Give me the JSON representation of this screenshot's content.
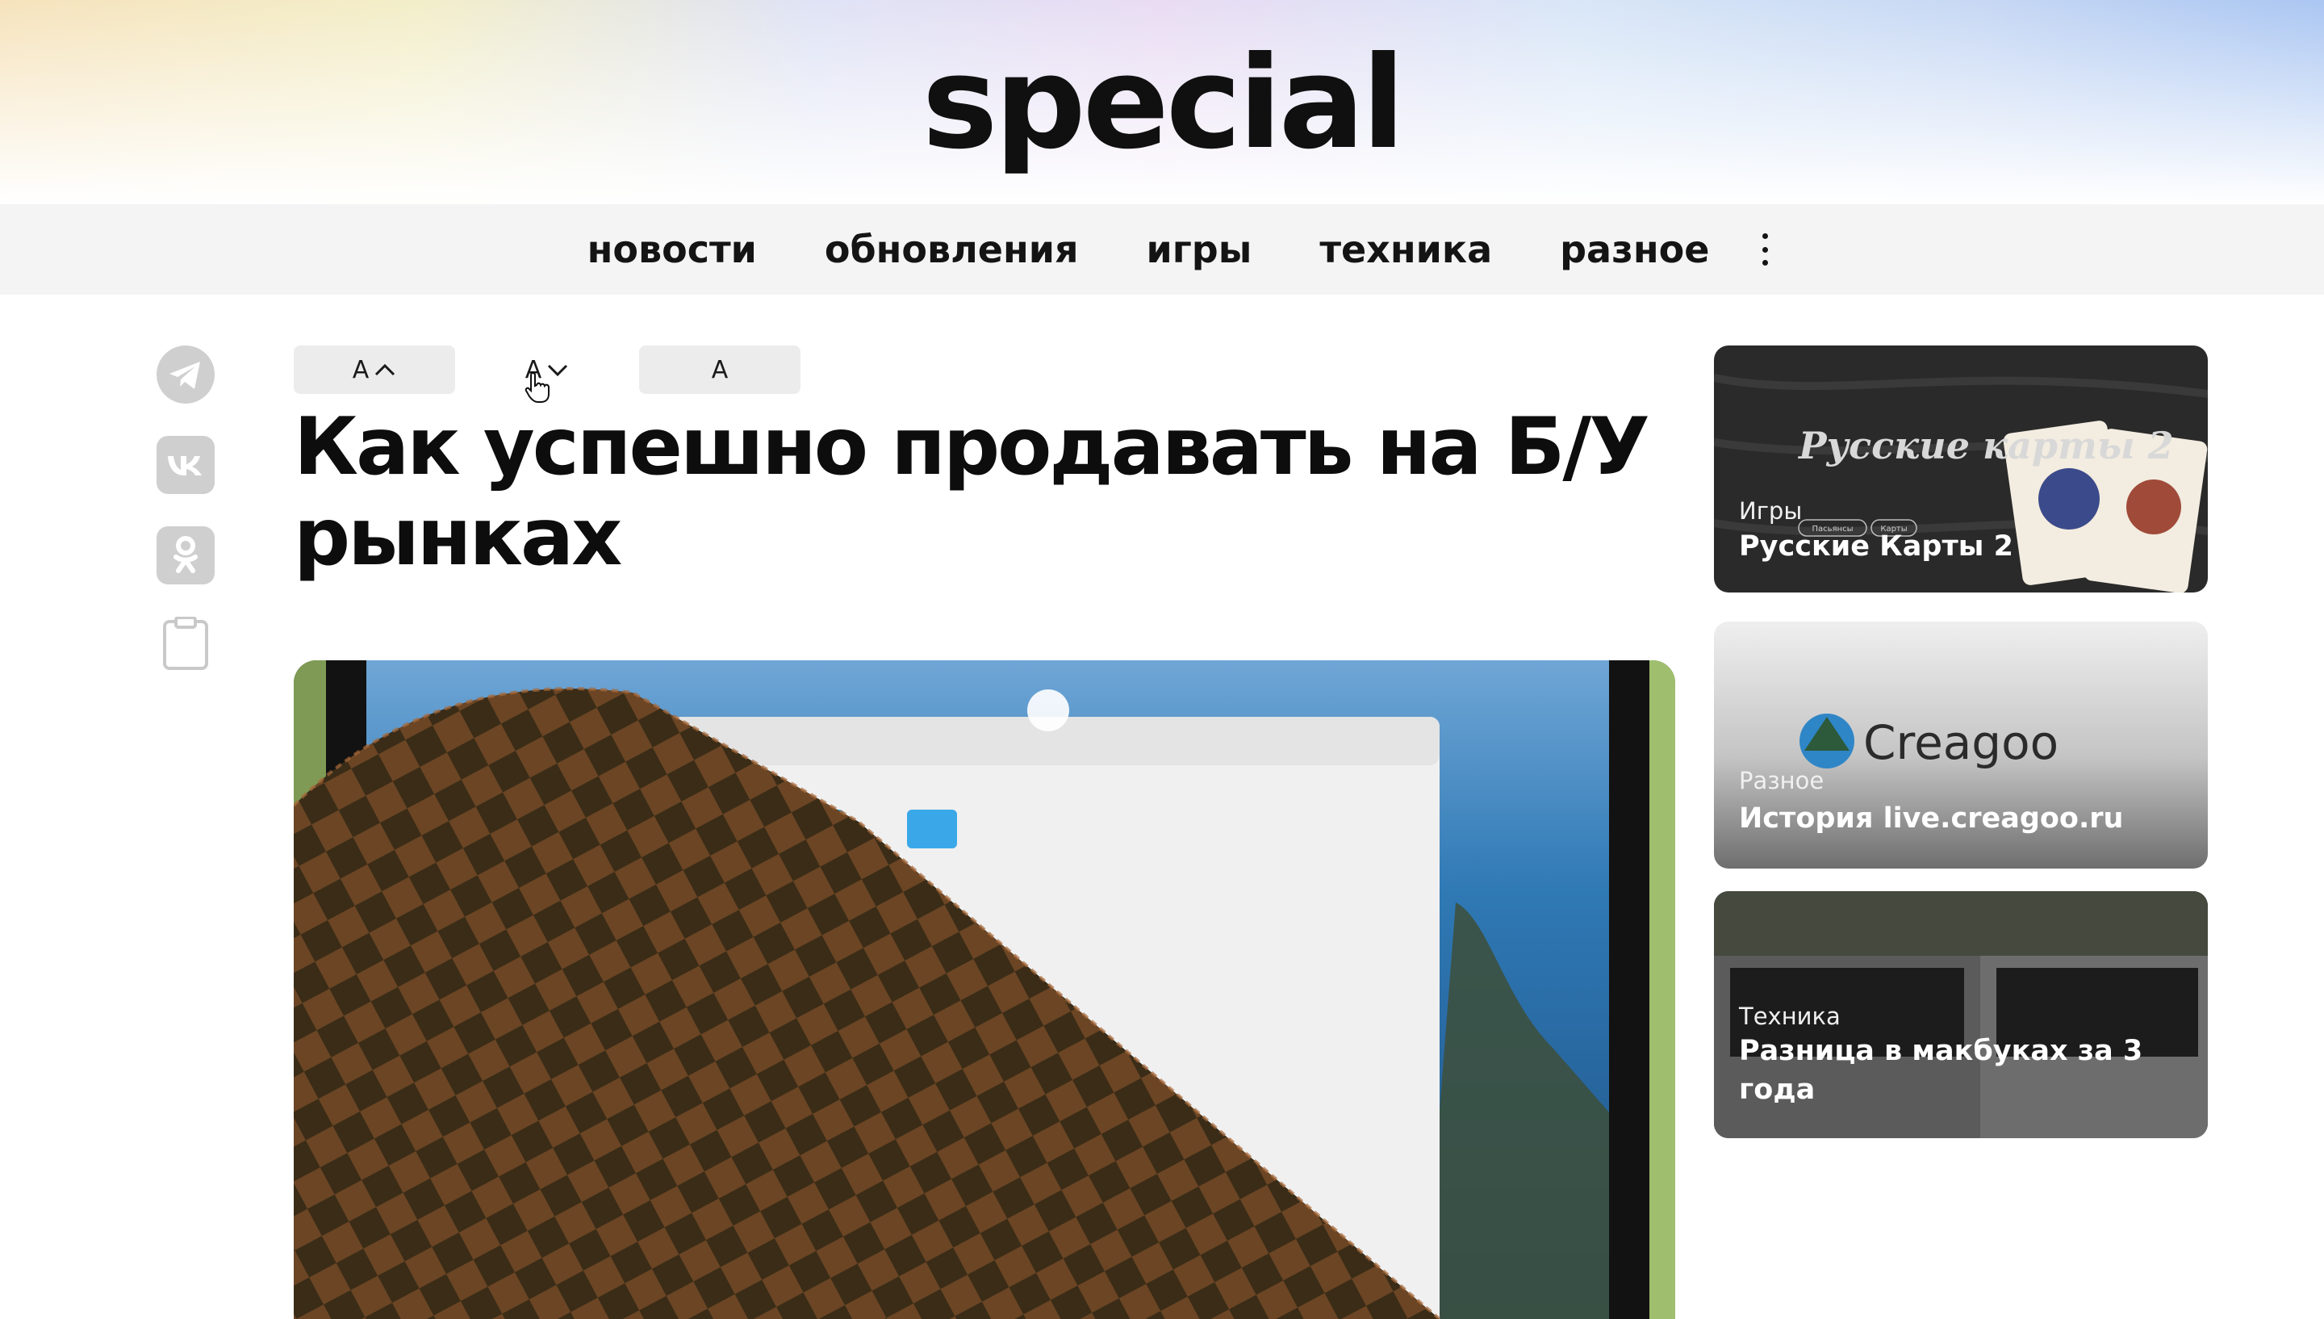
{
  "site": {
    "logo": "special"
  },
  "nav": {
    "items": [
      "новости",
      "обновления",
      "игры",
      "техника",
      "разное"
    ],
    "more_icon": "vertical-dots-icon"
  },
  "share": {
    "icons": [
      "telegram-icon",
      "vk-icon",
      "odnoklassniki-icon",
      "clipboard-icon"
    ]
  },
  "font_controls": {
    "increase_label": "A",
    "decrease_label": "A",
    "reset_label": "A"
  },
  "article": {
    "title": "Как успешно продавать на Б/У рынках"
  },
  "sidebar": {
    "cards": [
      {
        "category": "Игры",
        "title": "Русские Карты 2",
        "image_text": "Русские карты 2",
        "image_tags": [
          "Пасьянсы",
          "Карты"
        ]
      },
      {
        "category": "Разное",
        "title": "История live.creagoo.ru",
        "image_text": "Creagoo"
      },
      {
        "category": "Техника",
        "title": "Разница в макбуках за 3 года"
      }
    ]
  },
  "colors": {
    "nav_bg": "#f4f4f4",
    "button_bg": "#ececec",
    "icon_gray": "#c9c9c9"
  }
}
